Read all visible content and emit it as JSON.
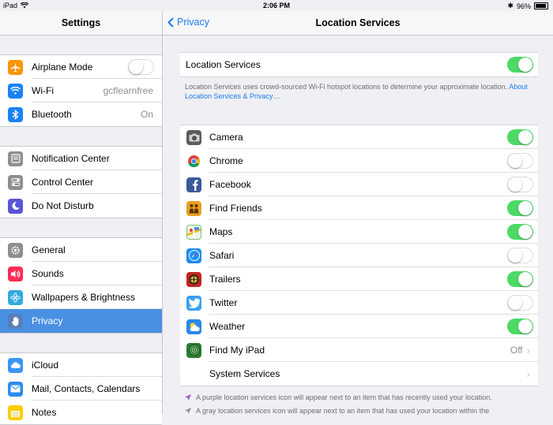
{
  "status": {
    "device": "iPad",
    "time": "2:06 PM",
    "battery": "96%",
    "battery_level": 0.96
  },
  "sidebar": {
    "title": "Settings",
    "groups": [
      [
        {
          "label": "Airplane Mode",
          "icon": "airplane-icon",
          "color": "#ff9500",
          "toggle": "off"
        },
        {
          "label": "Wi-Fi",
          "icon": "wifi-icon",
          "color": "#1a82f7",
          "value": "gcflearnfree"
        },
        {
          "label": "Bluetooth",
          "icon": "bluetooth-icon",
          "color": "#1a82f7",
          "value": "On"
        }
      ],
      [
        {
          "label": "Notification Center",
          "icon": "notification-icon",
          "color": "#8e8e93"
        },
        {
          "label": "Control Center",
          "icon": "control-center-icon",
          "color": "#8e8e93"
        },
        {
          "label": "Do Not Disturb",
          "icon": "moon-icon",
          "color": "#5856d6"
        }
      ],
      [
        {
          "label": "General",
          "icon": "gear-icon",
          "color": "#8e8e93"
        },
        {
          "label": "Sounds",
          "icon": "speaker-icon",
          "color": "#ff2d55"
        },
        {
          "label": "Wallpapers & Brightness",
          "icon": "flower-icon",
          "color": "#34aadc"
        },
        {
          "label": "Privacy",
          "icon": "hand-icon",
          "color": "#5a7fb8",
          "selected": true
        }
      ],
      [
        {
          "label": "iCloud",
          "icon": "cloud-icon",
          "color": "#3a95f5"
        },
        {
          "label": "Mail, Contacts, Calendars",
          "icon": "mail-icon",
          "color": "#2b8cf0"
        },
        {
          "label": "Notes",
          "icon": "notes-icon",
          "color": "#ffcc00"
        }
      ]
    ]
  },
  "main": {
    "back_label": "Privacy",
    "title": "Location Services",
    "master_label": "Location Services",
    "master_state": "on",
    "description": "Location Services uses crowd-sourced Wi-Fi hotspot locations to determine your approximate location.",
    "description_link": "About Location Services & Privacy…",
    "apps": [
      {
        "label": "Camera",
        "icon": "camera-icon",
        "color": "#5c5c5c",
        "toggle": "on"
      },
      {
        "label": "Chrome",
        "icon": "chrome-icon",
        "color": "#ffffff",
        "toggle": "off"
      },
      {
        "label": "Facebook",
        "icon": "facebook-icon",
        "color": "#3b5998",
        "toggle": "off"
      },
      {
        "label": "Find Friends",
        "icon": "find-friends-icon",
        "color": "#e8a020",
        "toggle": "on"
      },
      {
        "label": "Maps",
        "icon": "maps-icon",
        "color": "#7cc576",
        "toggle": "on"
      },
      {
        "label": "Safari",
        "icon": "compass-icon",
        "color": "#1a8cf0",
        "toggle": "off"
      },
      {
        "label": "Trailers",
        "icon": "trailers-icon",
        "color": "#c0271e",
        "toggle": "on"
      },
      {
        "label": "Twitter",
        "icon": "twitter-icon",
        "color": "#38a1f3",
        "toggle": "off"
      },
      {
        "label": "Weather",
        "icon": "weather-icon",
        "color": "#2a88e8",
        "toggle": "on"
      },
      {
        "label": "Find My iPad",
        "icon": "find-my-icon",
        "color": "#2d7d32",
        "value": "Off"
      },
      {
        "label": "System Services",
        "icon": "",
        "color": "",
        "chevron_only": true
      }
    ],
    "footer": [
      {
        "text": "A purple location services icon will appear next to an item that has recently used your location.",
        "color": "#a455d8"
      },
      {
        "text": "A gray location services icon will appear next to an item that has used your location within the",
        "color": "#8e8e93"
      }
    ]
  }
}
